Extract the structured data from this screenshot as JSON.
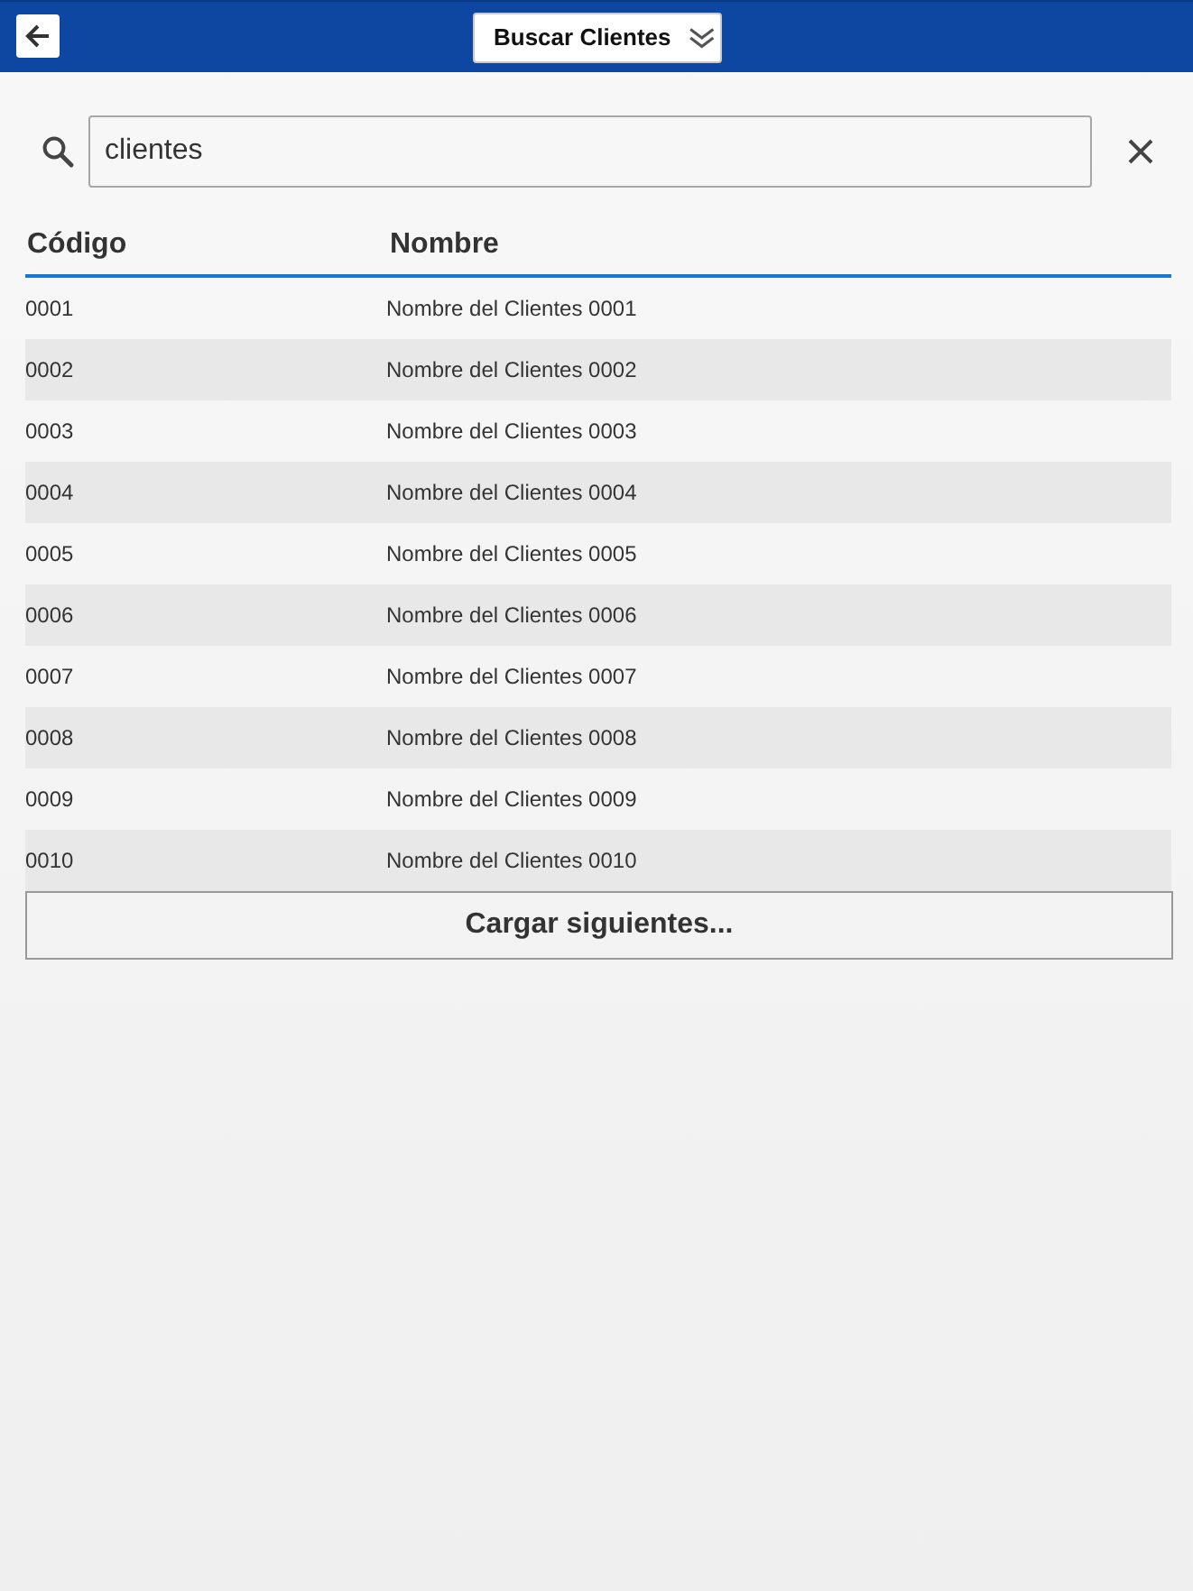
{
  "header": {
    "title": "Buscar Clientes"
  },
  "search": {
    "value": "clientes"
  },
  "table": {
    "columns": [
      "Código",
      "Nombre"
    ],
    "rows": [
      [
        "0001",
        "Nombre del Clientes 0001"
      ],
      [
        "0002",
        "Nombre del Clientes 0002"
      ],
      [
        "0003",
        "Nombre del Clientes 0003"
      ],
      [
        "0004",
        "Nombre del Clientes 0004"
      ],
      [
        "0005",
        "Nombre del Clientes 0005"
      ],
      [
        "0006",
        "Nombre del Clientes 0006"
      ],
      [
        "0007",
        "Nombre del Clientes 0007"
      ],
      [
        "0008",
        "Nombre del Clientes 0008"
      ],
      [
        "0009",
        "Nombre del Clientes 0009"
      ],
      [
        "0010",
        "Nombre del Clientes 0010"
      ]
    ]
  },
  "load_more_button": "Cargar siguientes..."
}
